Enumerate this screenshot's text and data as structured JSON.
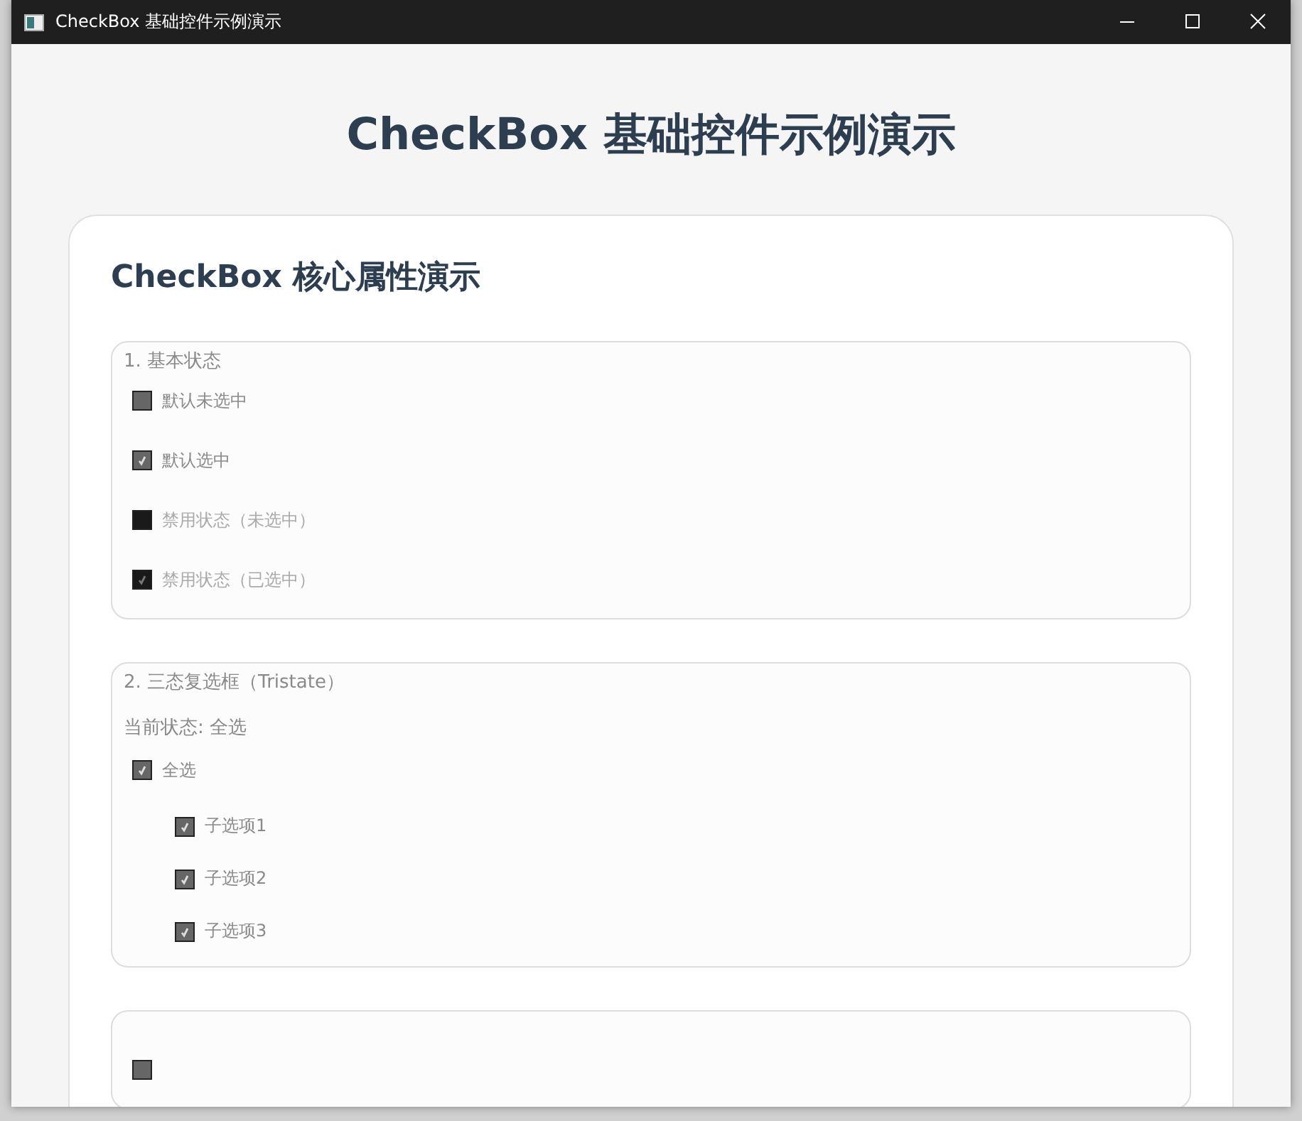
{
  "window": {
    "title": "CheckBox 基础控件示例演示"
  },
  "heading": "CheckBox 基础控件示例演示",
  "card": {
    "title": "CheckBox 核心属性演示",
    "groups": [
      {
        "title": "1. 基本状态",
        "items": [
          {
            "label": "默认未选中",
            "checked": false,
            "disabled": false
          },
          {
            "label": "默认选中",
            "checked": true,
            "disabled": false
          },
          {
            "label": "禁用状态（未选中）",
            "checked": false,
            "disabled": true
          },
          {
            "label": "禁用状态（已选中）",
            "checked": true,
            "disabled": true
          }
        ]
      },
      {
        "title": "2. 三态复选框（Tristate）",
        "status": "当前状态: 全选",
        "items": [
          {
            "label": "全选",
            "checked": true,
            "disabled": false,
            "children": [
              {
                "label": "子选项1",
                "checked": true,
                "disabled": false
              },
              {
                "label": "子选项2",
                "checked": true,
                "disabled": false
              },
              {
                "label": "子选项3",
                "checked": true,
                "disabled": false
              }
            ]
          }
        ]
      },
      {
        "items": [
          {
            "checked": false,
            "disabled": false
          }
        ]
      }
    ]
  }
}
